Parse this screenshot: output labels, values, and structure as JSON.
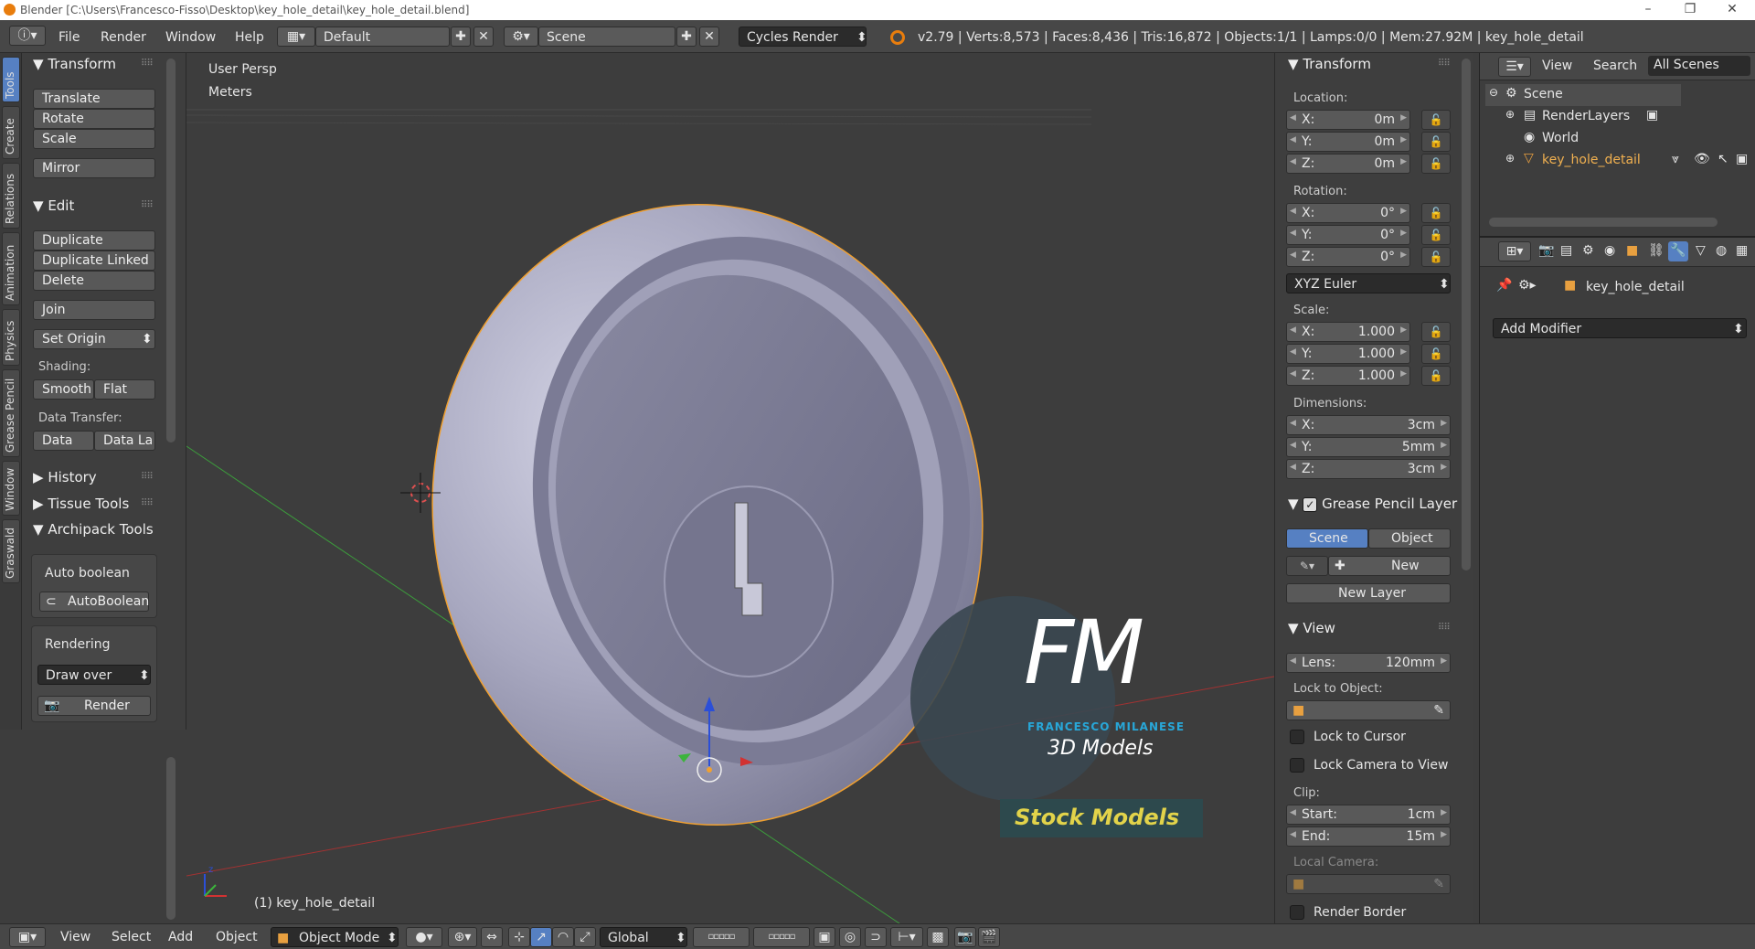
{
  "window": {
    "title": "Blender [C:\\Users\\Francesco-Fisso\\Desktop\\key_hole_detail\\key_hole_detail.blend]",
    "minimize": "–",
    "maximize": "❐",
    "close": "✕"
  },
  "infobar": {
    "menus": [
      "File",
      "Render",
      "Window",
      "Help"
    ],
    "layout": "Default",
    "scene": "Scene",
    "engine": "Cycles Render",
    "stats": "v2.79 | Verts:8,573 | Faces:8,436 | Tris:16,872 | Objects:1/1 | Lamps:0/0 | Mem:27.92M | key_hole_detail"
  },
  "left_tabs": [
    "Tools",
    "Create",
    "Relations",
    "Animation",
    "Physics",
    "Grease Pencil",
    "Window",
    "Graswald"
  ],
  "toolshelf": {
    "transform_title": "Transform",
    "translate": "Translate",
    "rotate": "Rotate",
    "scale": "Scale",
    "mirror": "Mirror",
    "edit_title": "Edit",
    "duplicate": "Duplicate",
    "duplicate_linked": "Duplicate Linked",
    "delete": "Delete",
    "join": "Join",
    "set_origin": "Set Origin",
    "shading_label": "Shading:",
    "smooth": "Smooth",
    "flat": "Flat",
    "data_transfer_label": "Data Transfer:",
    "data": "Data",
    "data_la": "Data La",
    "history": "History",
    "tissue_tools": "Tissue Tools",
    "archipack_tools": "Archipack Tools",
    "auto_boolean_label": "Auto boolean",
    "autoboolean_btn": "AutoBoolean",
    "rendering_label": "Rendering",
    "draw_over": "Draw over",
    "render_btn": "Render"
  },
  "viewport": {
    "view_name": "User Persp",
    "units": "Meters",
    "object_label": "(1) key_hole_detail",
    "watermark": {
      "logo": "FM",
      "brand": "FRANCESCO MILANESE",
      "sub": "3D Models",
      "banner": "Stock Models"
    }
  },
  "npanel": {
    "transform_title": "Transform",
    "location_label": "Location:",
    "location": [
      {
        "k": "X:",
        "v": "0m"
      },
      {
        "k": "Y:",
        "v": "0m"
      },
      {
        "k": "Z:",
        "v": "0m"
      }
    ],
    "rotation_label": "Rotation:",
    "rotation": [
      {
        "k": "X:",
        "v": "0°"
      },
      {
        "k": "Y:",
        "v": "0°"
      },
      {
        "k": "Z:",
        "v": "0°"
      }
    ],
    "rotation_mode": "XYZ Euler",
    "scale_label": "Scale:",
    "scale": [
      {
        "k": "X:",
        "v": "1.000"
      },
      {
        "k": "Y:",
        "v": "1.000"
      },
      {
        "k": "Z:",
        "v": "1.000"
      }
    ],
    "dimensions_label": "Dimensions:",
    "dimensions": [
      {
        "k": "X:",
        "v": "3cm"
      },
      {
        "k": "Y:",
        "v": "5mm"
      },
      {
        "k": "Z:",
        "v": "3cm"
      }
    ],
    "grease_title": "Grease Pencil Layer",
    "gp_scene": "Scene",
    "gp_object": "Object",
    "gp_new": "New",
    "gp_new_layer": "New Layer",
    "view_title": "View",
    "lens_k": "Lens:",
    "lens_v": "120mm",
    "lock_to_object": "Lock to Object:",
    "lock_to_cursor": "Lock to Cursor",
    "lock_camera": "Lock Camera to View",
    "clip_label": "Clip:",
    "clip_start_k": "Start:",
    "clip_start_v": "1cm",
    "clip_end_k": "End:",
    "clip_end_v": "15m",
    "local_camera": "Local Camera:",
    "render_border": "Render Border"
  },
  "outliner": {
    "menus": [
      "View",
      "Search"
    ],
    "filter": "All Scenes",
    "items": [
      {
        "label": "Scene",
        "indent": 0
      },
      {
        "label": "RenderLayers",
        "indent": 1
      },
      {
        "label": "World",
        "indent": 1
      },
      {
        "label": "key_hole_detail",
        "indent": 1
      }
    ]
  },
  "properties": {
    "object_name": "key_hole_detail",
    "add_modifier": "Add Modifier"
  },
  "bottombar": {
    "menus": [
      "View",
      "Select",
      "Add",
      "Object"
    ],
    "mode": "Object Mode",
    "orientation": "Global"
  },
  "colors": {
    "accent": "#5680c2",
    "selection_outline": "#f0a030",
    "x_axis": "#c83232",
    "y_axis": "#3c9b3c",
    "z_axis": "#2b4fd8"
  }
}
